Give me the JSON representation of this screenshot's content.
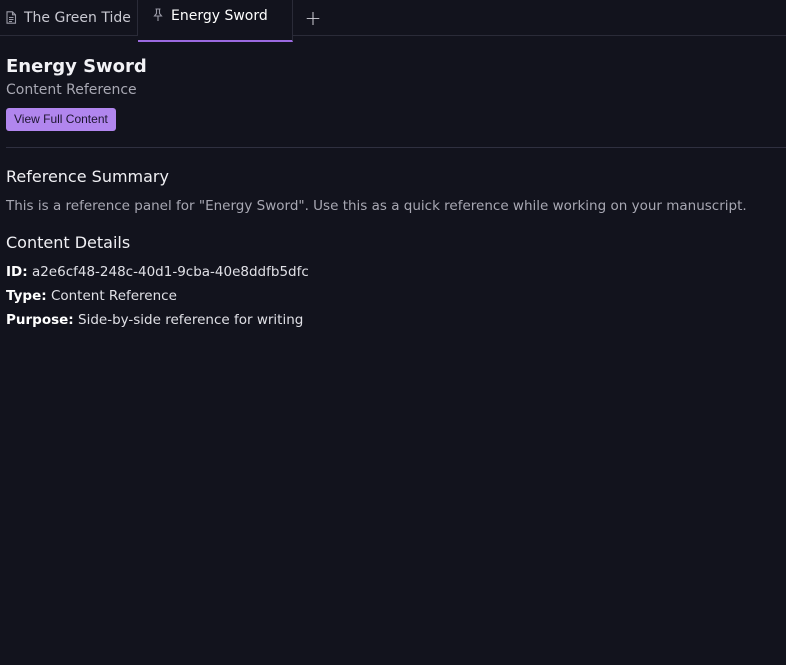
{
  "tabs": [
    {
      "label": "The Green Tide",
      "icon": "document-icon"
    },
    {
      "label": "Energy Sword",
      "icon": "pin-icon",
      "active": true
    }
  ],
  "add_tab_label": "+",
  "header": {
    "title": "Energy Sword",
    "subtitle": "Content Reference",
    "button_label": "View Full Content"
  },
  "summary": {
    "heading": "Reference Summary",
    "text": "This is a reference panel for \"Energy Sword\". Use this as a quick reference while working on your manuscript."
  },
  "details": {
    "heading": "Content Details",
    "id_label": "ID:",
    "id_value": "a2e6cf48-248c-40d1-9cba-40e8ddfb5dfc",
    "type_label": "Type:",
    "type_value": "Content Reference",
    "purpose_label": "Purpose:",
    "purpose_value": "Side-by-side reference for writing"
  },
  "colors": {
    "background": "#12131d",
    "accent": "#b186ee",
    "active_tab_underline": "#9b6ae0"
  }
}
